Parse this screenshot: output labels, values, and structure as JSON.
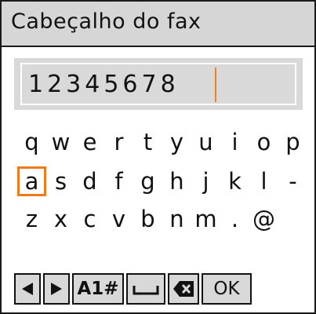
{
  "header": {
    "title": "Cabeçalho do fax"
  },
  "input": {
    "value": "12345678"
  },
  "keyboard": {
    "rows": [
      [
        "q",
        "w",
        "e",
        "r",
        "t",
        "y",
        "u",
        "i",
        "o",
        "p"
      ],
      [
        "a",
        "s",
        "d",
        "f",
        "g",
        "h",
        "j",
        "k",
        "l",
        "-"
      ],
      [
        "z",
        "x",
        "c",
        "v",
        "b",
        "n",
        "m",
        ".",
        "@"
      ]
    ],
    "selected_key": "a",
    "accent_color": "#f07a1a"
  },
  "toolbar": {
    "left_icon": "left-arrow-icon",
    "right_icon": "right-arrow-icon",
    "mode_label": "A1#",
    "space_icon": "space-icon",
    "backspace_icon": "backspace-icon",
    "ok_label": "OK"
  }
}
